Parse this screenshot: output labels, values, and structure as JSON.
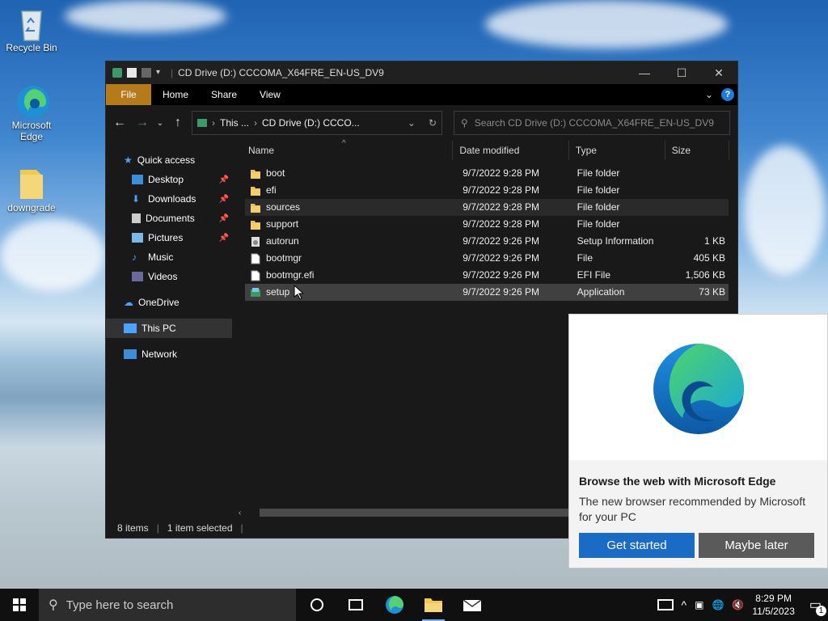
{
  "desktop": {
    "icons": [
      {
        "label": "Recycle Bin"
      },
      {
        "label": "Microsoft Edge"
      },
      {
        "label": "downgrade"
      }
    ]
  },
  "explorer": {
    "title": "CD Drive (D:) CCCOMA_X64FRE_EN-US_DV9",
    "ribbon_tabs": [
      "File",
      "Home",
      "Share",
      "View"
    ],
    "address": {
      "root": "This ...",
      "current": "CD Drive (D:) CCCO..."
    },
    "search_placeholder": "Search CD Drive (D:) CCCOMA_X64FRE_EN-US_DV9",
    "nav": {
      "quick_access": "Quick access",
      "quick_items": [
        "Desktop",
        "Downloads",
        "Documents",
        "Pictures",
        "Music",
        "Videos"
      ],
      "onedrive": "OneDrive",
      "this_pc": "This PC",
      "network": "Network"
    },
    "columns": [
      "Name",
      "Date modified",
      "Type",
      "Size"
    ],
    "files": [
      {
        "name": "boot",
        "date": "9/7/2022 9:28 PM",
        "type": "File folder",
        "size": "",
        "icon": "folder-icon"
      },
      {
        "name": "efi",
        "date": "9/7/2022 9:28 PM",
        "type": "File folder",
        "size": "",
        "icon": "folder-icon"
      },
      {
        "name": "sources",
        "date": "9/7/2022 9:28 PM",
        "type": "File folder",
        "size": "",
        "icon": "folder-icon"
      },
      {
        "name": "support",
        "date": "9/7/2022 9:28 PM",
        "type": "File folder",
        "size": "",
        "icon": "folder-icon"
      },
      {
        "name": "autorun",
        "date": "9/7/2022 9:26 PM",
        "type": "Setup Information",
        "size": "1 KB",
        "icon": "setup-info-icon"
      },
      {
        "name": "bootmgr",
        "date": "9/7/2022 9:26 PM",
        "type": "File",
        "size": "405 KB",
        "icon": "file-icon"
      },
      {
        "name": "bootmgr.efi",
        "date": "9/7/2022 9:26 PM",
        "type": "EFI File",
        "size": "1,506 KB",
        "icon": "file-icon"
      },
      {
        "name": "setup",
        "date": "9/7/2022 9:26 PM",
        "type": "Application",
        "size": "73 KB",
        "icon": "setup-app-icon"
      }
    ],
    "status": {
      "items": "8 items",
      "selected": "1 item selected"
    }
  },
  "edge_popup": {
    "heading": "Browse the web with Microsoft Edge",
    "body": "The new browser recommended by Microsoft for your PC",
    "primary": "Get started",
    "secondary": "Maybe later"
  },
  "taskbar": {
    "search_placeholder": "Type here to search",
    "time": "8:29 PM",
    "date": "11/5/2023",
    "notification_count": "1"
  },
  "colors": {
    "accent": "#1a6bc6",
    "file_tab": "#b57a1a",
    "folder": "#e8c15a"
  }
}
